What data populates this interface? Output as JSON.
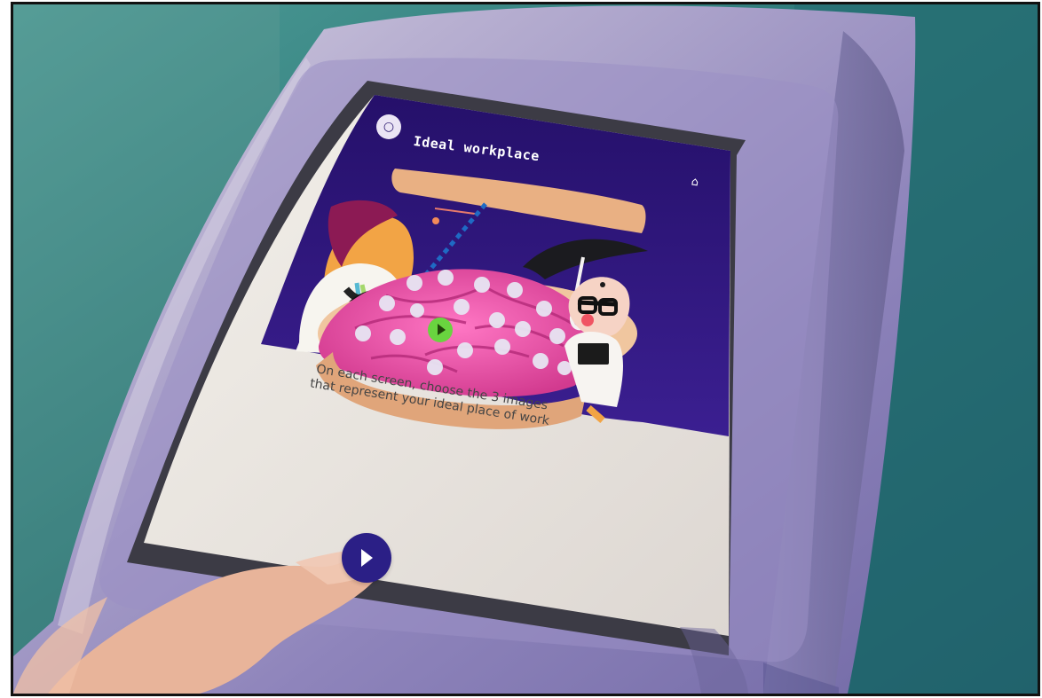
{
  "screen": {
    "title": "Ideal workplace",
    "instructions": "On each screen, choose the 3 images that represent your ideal place of work"
  },
  "icons": {
    "back": "back-circle-icon",
    "home": "home-icon",
    "next": "play-arrow-icon"
  },
  "colors": {
    "screen_background": "#2a186f",
    "panel_background": "#f4f1eb",
    "brain": "#e7479c",
    "highlight": "#69d43f",
    "next_button": "#2b1f86",
    "kiosk_frame": "#9f96c5"
  }
}
